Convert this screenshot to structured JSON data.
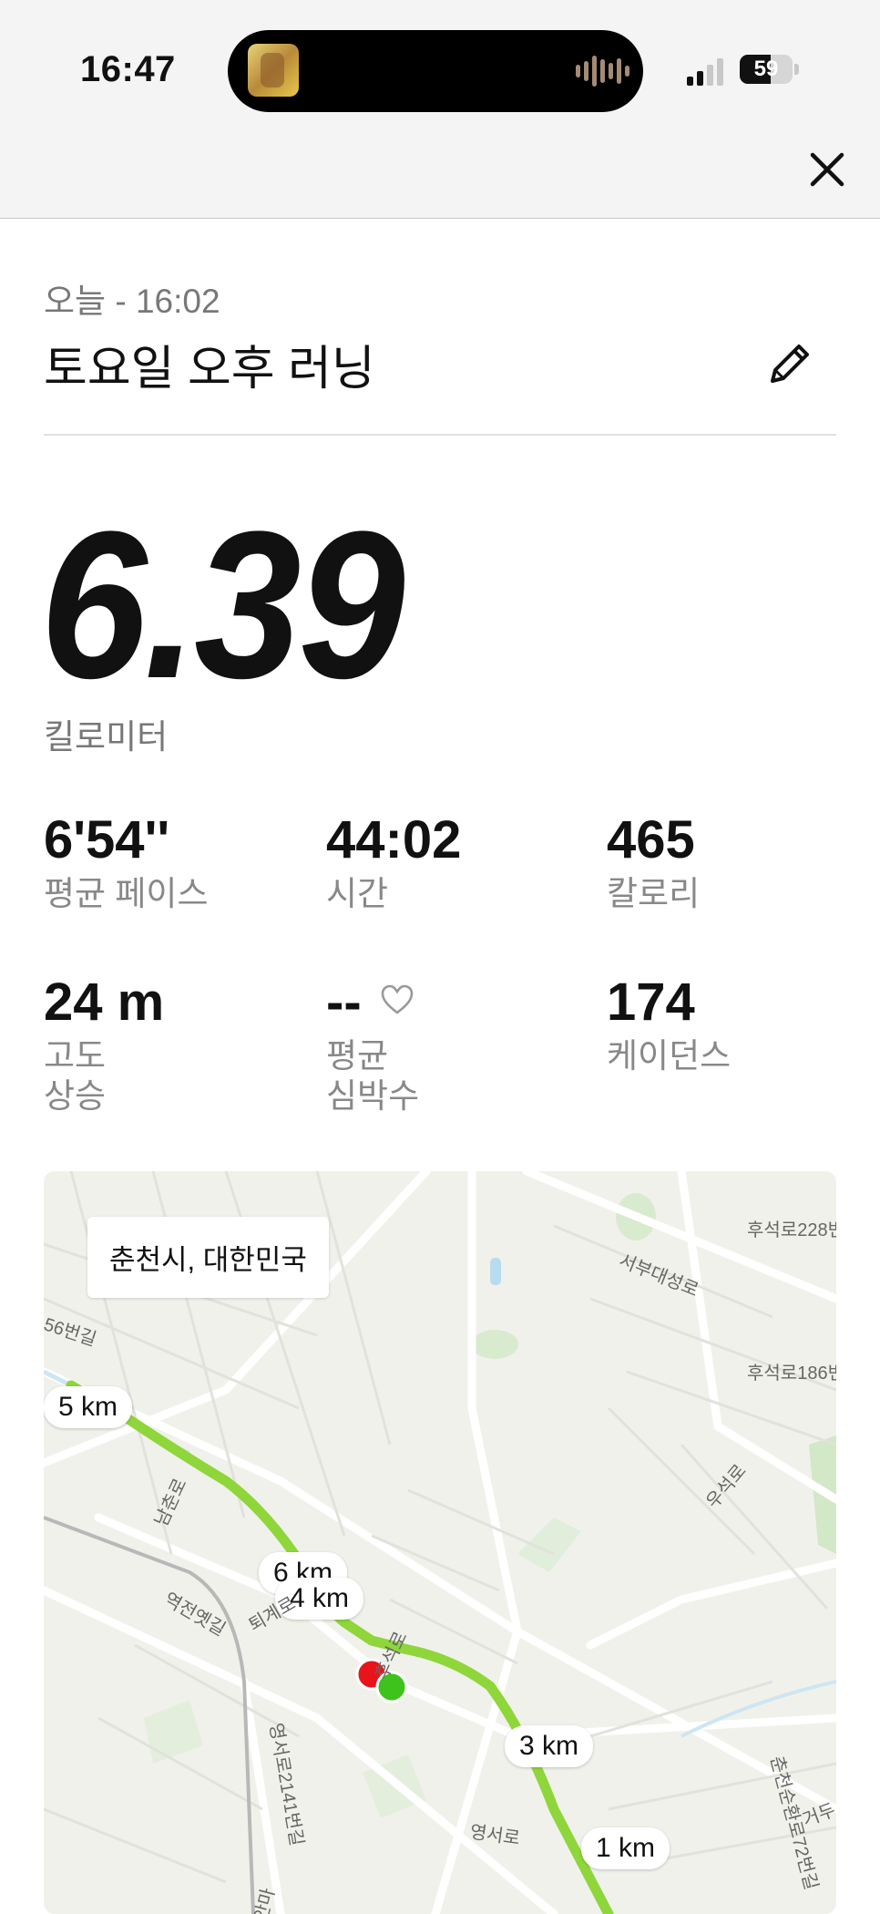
{
  "status_bar": {
    "time": "16:47",
    "battery_percent": "59",
    "battery_level": 0.59
  },
  "header": {
    "close_icon": "close-icon"
  },
  "activity": {
    "date": "오늘 - 16:02",
    "title": "토요일 오후 러닝",
    "edit_icon": "pencil-icon",
    "distance": "6.39",
    "distance_unit": "킬로미터"
  },
  "stats": [
    {
      "value": "6'54''",
      "label": "평균 페이스"
    },
    {
      "value": "44:02",
      "label": "시간"
    },
    {
      "value": "465",
      "label": "칼로리"
    },
    {
      "value": "24 m",
      "label_line1": "고도",
      "label_line2": "상승"
    },
    {
      "value": "--",
      "label_line1": "평균",
      "label_line2": "심박수"
    },
    {
      "value": "174",
      "label": "케이던스"
    }
  ],
  "map": {
    "location": "춘천시, 대한민국",
    "km_markers": [
      "5 km",
      "6 km",
      "4 km",
      "3 km",
      "1 km"
    ],
    "streets": [
      "후석로228번",
      "서부대성로",
      "56번길",
      "후석로186번",
      "우석로",
      "남춘로",
      "역전옛길",
      "퇴계로",
      "후석로",
      "영서로2141번길",
      "영서로",
      "춘천순환로72번길",
      "거두",
      "안마"
    ],
    "route_color": "#8fd63a",
    "start_color": "#3ec21c",
    "end_color": "#e8131b"
  }
}
